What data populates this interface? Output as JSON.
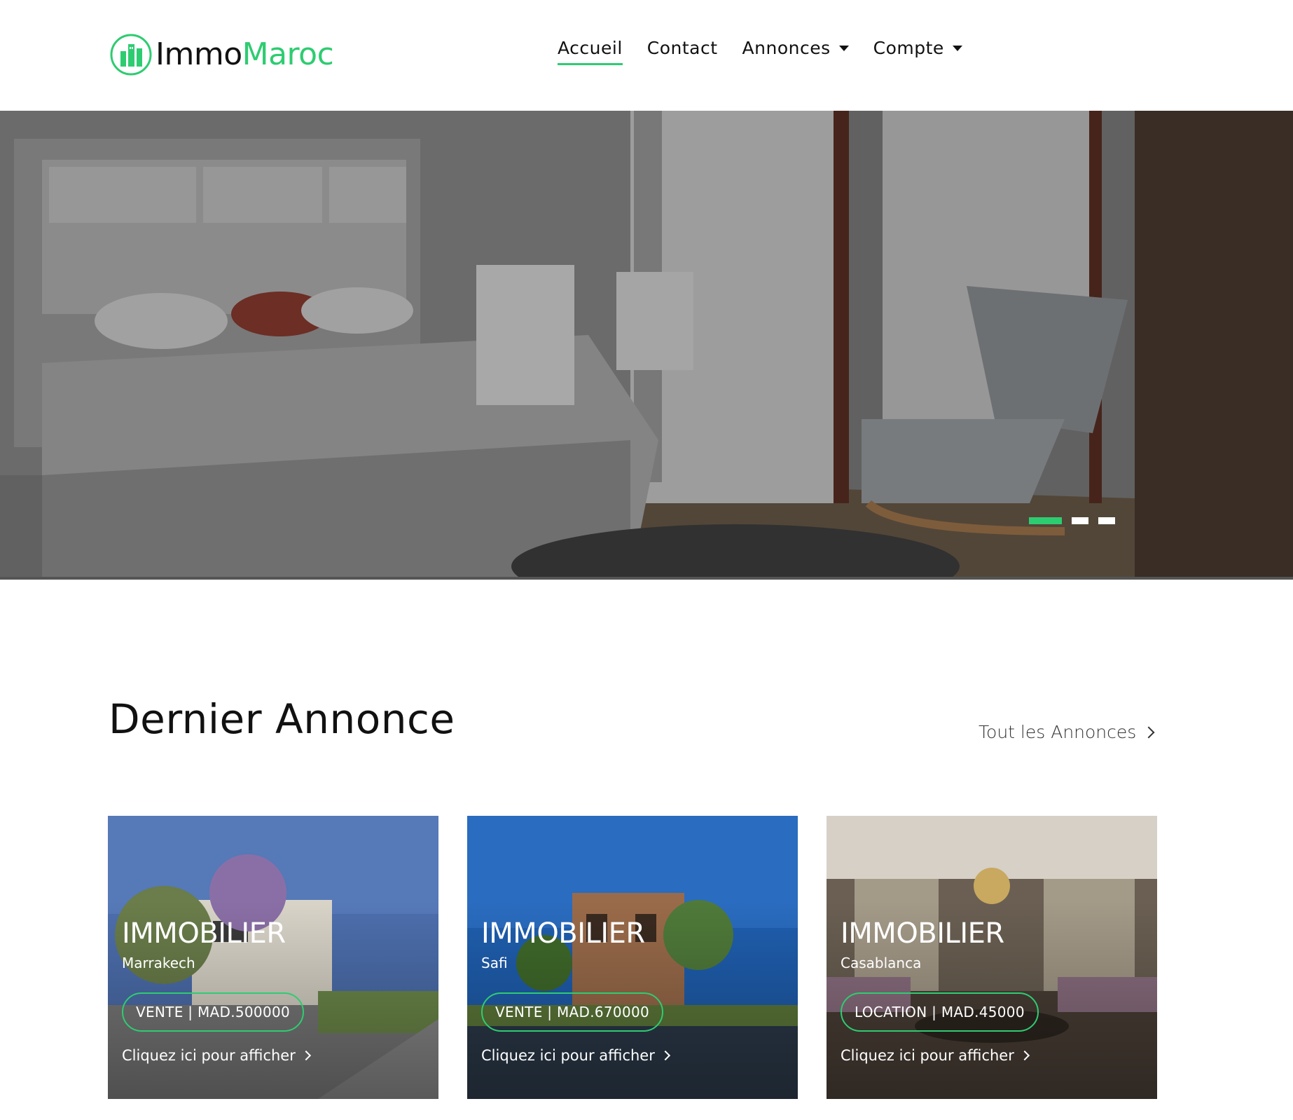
{
  "brand": {
    "name_part1": "Immo",
    "name_part2": "Maroc",
    "logo_icon": "building-circle-icon",
    "accent_color": "#2ecc71"
  },
  "nav": {
    "items": [
      {
        "label": "Accueil",
        "active": true,
        "dropdown": false
      },
      {
        "label": "Contact",
        "active": false,
        "dropdown": false
      },
      {
        "label": "Annonces",
        "active": false,
        "dropdown": true
      },
      {
        "label": "Compte",
        "active": false,
        "dropdown": true
      }
    ]
  },
  "hero": {
    "slide_count": 3,
    "active_slide": 1
  },
  "section": {
    "title": "Dernier Annonce",
    "all_link": "Tout les Annonces"
  },
  "cards": [
    {
      "title": "IMMOBILIER",
      "city": "Marrakech",
      "badge": "VENTE | MAD.500000",
      "link": "Cliquez ici pour afficher"
    },
    {
      "title": "IMMOBILIER",
      "city": "Safi",
      "badge": "VENTE | MAD.670000",
      "link": "Cliquez ici pour afficher"
    },
    {
      "title": "IMMOBILIER",
      "city": "Casablanca",
      "badge": "LOCATION | MAD.45000",
      "link": "Cliquez ici pour afficher"
    }
  ]
}
